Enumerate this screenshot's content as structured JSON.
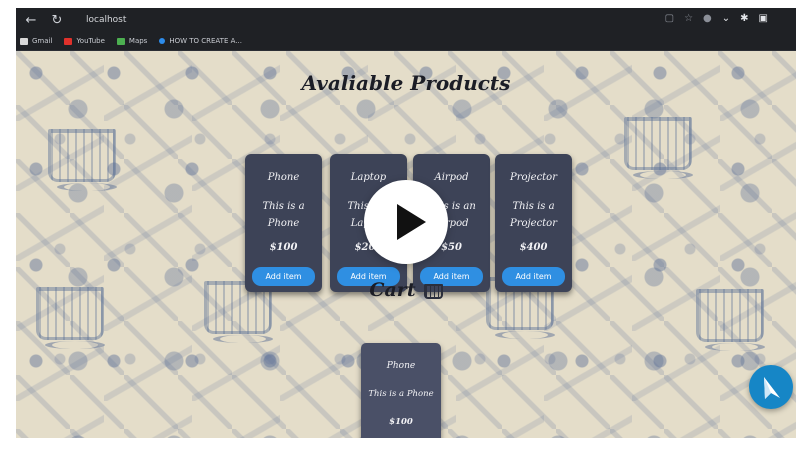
{
  "browser": {
    "url": "localhost",
    "bookmarks": [
      {
        "label": "Gmail",
        "color": "#d8d8d8"
      },
      {
        "label": "YouTube",
        "color": "#e0312b"
      },
      {
        "label": "Maps",
        "color": "#4caf50"
      },
      {
        "label": "HOW TO CREATE A...",
        "color": "#2d8ceb"
      }
    ]
  },
  "page": {
    "products_title": "Avaliable Products",
    "cart_title": "Cart",
    "products": [
      {
        "name": "Phone",
        "description": "This is a Phone",
        "price": "$100",
        "button": "Add item"
      },
      {
        "name": "Laptop",
        "description": "This is a Laptop",
        "price": "$200",
        "button": "Add item"
      },
      {
        "name": "Airpod",
        "description": "This is an Airpod",
        "price": "$50",
        "button": "Add item"
      },
      {
        "name": "Projector",
        "description": "This is a Projector",
        "price": "$400",
        "button": "Add item"
      }
    ],
    "cart": [
      {
        "name": "Phone",
        "description": "This is a Phone",
        "price": "$100"
      }
    ]
  },
  "colors": {
    "accent": "#2f8fe2",
    "card": "#3d4357",
    "background": "#e4ddc9"
  }
}
